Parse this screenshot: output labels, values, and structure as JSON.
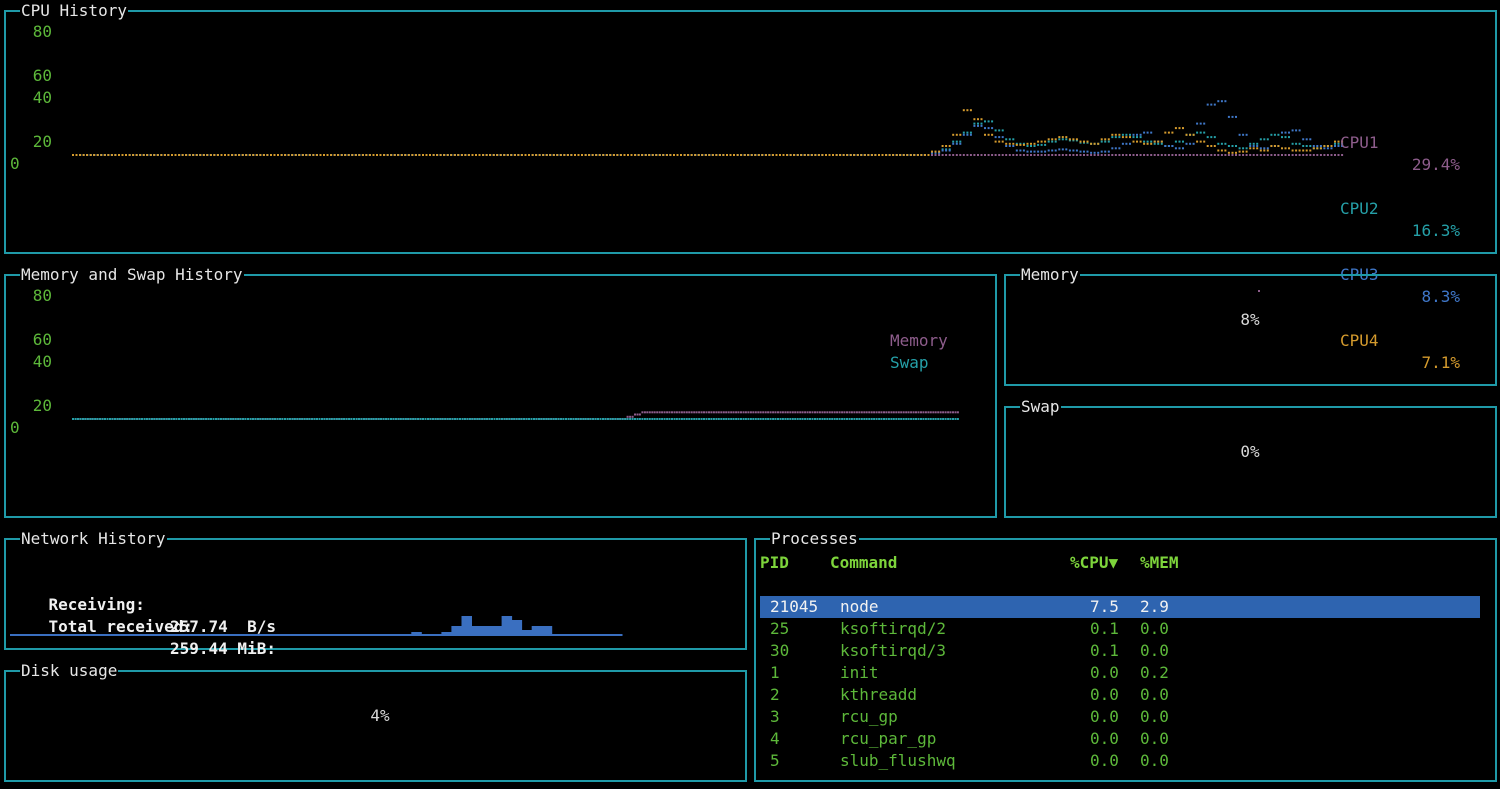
{
  "cpu_panel": {
    "title": "CPU History",
    "y_ticks": [
      "80",
      "60",
      "40",
      "20",
      "0"
    ],
    "legend": [
      {
        "name": "CPU1",
        "value": "29.4%",
        "color": "#8e5d8c"
      },
      {
        "name": "CPU2",
        "value": "16.3%",
        "color": "#25a0a8"
      },
      {
        "name": "CPU3",
        "value": "8.3%",
        "color": "#3f77c9"
      },
      {
        "name": "CPU4",
        "value": "7.1%",
        "color": "#d59b2d"
      }
    ]
  },
  "mem_panel": {
    "title": "Memory and Swap History",
    "y_ticks": [
      "80",
      "60",
      "40",
      "20",
      "0"
    ],
    "legend": [
      {
        "name": "Memory",
        "color": "#8e5d8c"
      },
      {
        "name": "Swap",
        "color": "#25a0a8"
      }
    ]
  },
  "memory_gauge": {
    "title": "Memory",
    "value": "8%"
  },
  "swap_gauge": {
    "title": "Swap",
    "value": "0%"
  },
  "network": {
    "title": "Network History",
    "receiving_label": "Receiving:",
    "receiving_value": "257.74  B/s",
    "total_label": "Total received:",
    "total_value": "259.44 MiB:"
  },
  "disk": {
    "title": "Disk usage",
    "value": "4%"
  },
  "processes": {
    "title": "Processes",
    "headers": {
      "pid": "PID",
      "command": "Command",
      "cpu": "%CPU▼",
      "mem": "%MEM"
    },
    "rows": [
      {
        "pid": "21045",
        "command": "node",
        "cpu": "7.5",
        "mem": "2.9"
      },
      {
        "pid": "25",
        "command": "ksoftirqd/2",
        "cpu": "0.1",
        "mem": "0.0"
      },
      {
        "pid": "30",
        "command": "ksoftirqd/3",
        "cpu": "0.1",
        "mem": "0.0"
      },
      {
        "pid": "1",
        "command": "init",
        "cpu": "0.0",
        "mem": "0.2"
      },
      {
        "pid": "2",
        "command": "kthreadd",
        "cpu": "0.0",
        "mem": "0.0"
      },
      {
        "pid": "3",
        "command": "rcu_gp",
        "cpu": "0.0",
        "mem": "0.0"
      },
      {
        "pid": "4",
        "command": "rcu_par_gp",
        "cpu": "0.0",
        "mem": "0.0"
      },
      {
        "pid": "5",
        "command": "slub_flushwq",
        "cpu": "0.0",
        "mem": "0.0"
      }
    ]
  },
  "colors": {
    "border": "#1f9aa8",
    "axis_green": "#5db83a",
    "header_green": "#7dd43b",
    "selection": "#2e64b0",
    "net_bar": "#3a6fc0"
  },
  "chart_data": [
    {
      "type": "line",
      "title": "CPU History",
      "ylim": [
        0,
        100
      ],
      "x_samples": 120,
      "series": [
        {
          "name": "CPU1",
          "values": [
            0,
            0,
            0,
            0,
            0,
            0,
            0,
            0,
            0,
            0,
            0,
            0,
            0,
            0,
            0,
            0,
            0,
            0,
            0,
            0,
            0,
            0,
            0,
            0,
            0,
            0,
            0,
            0,
            0,
            0,
            0,
            0,
            0,
            0,
            0,
            0,
            0,
            0,
            0,
            0,
            0,
            0,
            0,
            0,
            0,
            0,
            0,
            0,
            0,
            0,
            0,
            0,
            0,
            0,
            0,
            0,
            0,
            0,
            0,
            0,
            0,
            0,
            0,
            0,
            0,
            0,
            0,
            0,
            0,
            0,
            0,
            0,
            0,
            0,
            0,
            0,
            0,
            0,
            0,
            0,
            0,
            0,
            0,
            0,
            0,
            0,
            0,
            0,
            0,
            0,
            0,
            0,
            0,
            0,
            0,
            0,
            0,
            0,
            0,
            0,
            0,
            0,
            0,
            0,
            0,
            0,
            0,
            0,
            0,
            0,
            0,
            0,
            0,
            0,
            0,
            0,
            0,
            0,
            0,
            0
          ]
        },
        {
          "name": "CPU2",
          "values": [
            0,
            0,
            0,
            0,
            0,
            0,
            0,
            0,
            0,
            0,
            0,
            0,
            0,
            0,
            0,
            0,
            0,
            0,
            0,
            0,
            0,
            0,
            0,
            0,
            0,
            0,
            0,
            0,
            0,
            0,
            0,
            0,
            0,
            0,
            0,
            0,
            0,
            0,
            0,
            0,
            0,
            0,
            0,
            0,
            0,
            0,
            0,
            0,
            0,
            0,
            0,
            0,
            0,
            0,
            0,
            0,
            0,
            0,
            0,
            0,
            0,
            0,
            0,
            0,
            0,
            0,
            0,
            0,
            0,
            0,
            0,
            0,
            0,
            0,
            0,
            0,
            0,
            0,
            0,
            0,
            0,
            2,
            5,
            12,
            20,
            28,
            30,
            22,
            14,
            10,
            8,
            9,
            12,
            14,
            13,
            11,
            10,
            12,
            16,
            18,
            16,
            12,
            10,
            8,
            12,
            18,
            20,
            16,
            10,
            8,
            6,
            10,
            14,
            18,
            16,
            10,
            8,
            6,
            8,
            10
          ]
        },
        {
          "name": "CPU3",
          "values": [
            0,
            0,
            0,
            0,
            0,
            0,
            0,
            0,
            0,
            0,
            0,
            0,
            0,
            0,
            0,
            0,
            0,
            0,
            0,
            0,
            0,
            0,
            0,
            0,
            0,
            0,
            0,
            0,
            0,
            0,
            0,
            0,
            0,
            0,
            0,
            0,
            0,
            0,
            0,
            0,
            0,
            0,
            0,
            0,
            0,
            0,
            0,
            0,
            0,
            0,
            0,
            0,
            0,
            0,
            0,
            0,
            0,
            0,
            0,
            0,
            0,
            0,
            0,
            0,
            0,
            0,
            0,
            0,
            0,
            0,
            0,
            0,
            0,
            0,
            0,
            0,
            0,
            0,
            0,
            0,
            0,
            2,
            4,
            10,
            18,
            26,
            24,
            16,
            8,
            4,
            3,
            3,
            4,
            5,
            4,
            3,
            2,
            3,
            6,
            10,
            18,
            20,
            12,
            8,
            6,
            10,
            28,
            45,
            48,
            34,
            18,
            8,
            6,
            8,
            20,
            22,
            14,
            8,
            6,
            8
          ]
        },
        {
          "name": "CPU4",
          "values": [
            0,
            0,
            0,
            0,
            0,
            0,
            0,
            0,
            0,
            0,
            0,
            0,
            0,
            0,
            0,
            0,
            0,
            0,
            0,
            0,
            0,
            0,
            0,
            0,
            0,
            0,
            0,
            0,
            0,
            0,
            0,
            0,
            0,
            0,
            0,
            0,
            0,
            0,
            0,
            0,
            0,
            0,
            0,
            0,
            0,
            0,
            0,
            0,
            0,
            0,
            0,
            0,
            0,
            0,
            0,
            0,
            0,
            0,
            0,
            0,
            0,
            0,
            0,
            0,
            0,
            0,
            0,
            0,
            0,
            0,
            0,
            0,
            0,
            0,
            0,
            0,
            0,
            0,
            0,
            0,
            0,
            3,
            8,
            18,
            40,
            32,
            18,
            12,
            10,
            9,
            10,
            12,
            14,
            16,
            14,
            12,
            10,
            14,
            18,
            16,
            12,
            10,
            12,
            20,
            24,
            18,
            12,
            8,
            4,
            2,
            3,
            6,
            4,
            8,
            6,
            4,
            4,
            6,
            8,
            12
          ]
        }
      ]
    },
    {
      "type": "line",
      "title": "Memory and Swap History",
      "ylim": [
        0,
        100
      ],
      "x_samples": 120,
      "series": [
        {
          "name": "Memory",
          "values": [
            0,
            0,
            0,
            0,
            0,
            0,
            0,
            0,
            0,
            0,
            0,
            0,
            0,
            0,
            0,
            0,
            0,
            0,
            0,
            0,
            0,
            0,
            0,
            0,
            0,
            0,
            0,
            0,
            0,
            0,
            0,
            0,
            0,
            0,
            0,
            0,
            0,
            0,
            0,
            0,
            0,
            0,
            0,
            0,
            0,
            0,
            0,
            0,
            0,
            0,
            0,
            0,
            0,
            0,
            0,
            0,
            0,
            0,
            0,
            0,
            0,
            0,
            0,
            0,
            0,
            0,
            0,
            0,
            0,
            0,
            0,
            0,
            0,
            0,
            0,
            2,
            4,
            6,
            6,
            6,
            6,
            6,
            6,
            6,
            6,
            6,
            6,
            6,
            6,
            6,
            6,
            6,
            6,
            6,
            6,
            6,
            6,
            6,
            6,
            6,
            6,
            6,
            6,
            6,
            6,
            6,
            6,
            6,
            6,
            6,
            6,
            6,
            6,
            6,
            6,
            6,
            6,
            6,
            6,
            6
          ]
        },
        {
          "name": "Swap",
          "values": [
            0,
            0,
            0,
            0,
            0,
            0,
            0,
            0,
            0,
            0,
            0,
            0,
            0,
            0,
            0,
            0,
            0,
            0,
            0,
            0,
            0,
            0,
            0,
            0,
            0,
            0,
            0,
            0,
            0,
            0,
            0,
            0,
            0,
            0,
            0,
            0,
            0,
            0,
            0,
            0,
            0,
            0,
            0,
            0,
            0,
            0,
            0,
            0,
            0,
            0,
            0,
            0,
            0,
            0,
            0,
            0,
            0,
            0,
            0,
            0,
            0,
            0,
            0,
            0,
            0,
            0,
            0,
            0,
            0,
            0,
            0,
            0,
            0,
            0,
            0,
            0,
            0,
            0,
            0,
            0,
            0,
            0,
            0,
            0,
            0,
            0,
            0,
            0,
            0,
            0,
            0,
            0,
            0,
            0,
            0,
            0,
            0,
            0,
            0,
            0,
            0,
            0,
            0,
            0,
            0,
            0,
            0,
            0,
            0,
            0,
            0,
            0,
            0,
            0,
            0,
            0,
            0,
            0,
            0,
            0
          ]
        }
      ]
    },
    {
      "type": "bar",
      "title": "Network History",
      "values": [
        0,
        0,
        0,
        0,
        0,
        0,
        0,
        0,
        0,
        0,
        0,
        0,
        0,
        0,
        0,
        0,
        0,
        0,
        0,
        0,
        0,
        0,
        0,
        0,
        0,
        0,
        0,
        0,
        0,
        0,
        0,
        0,
        0,
        0,
        0,
        0,
        0,
        0,
        0,
        0,
        1,
        0,
        0,
        1,
        4,
        9,
        4,
        4,
        4,
        9,
        7,
        2,
        4,
        4,
        0,
        0,
        0,
        0,
        0,
        0,
        0
      ]
    }
  ]
}
